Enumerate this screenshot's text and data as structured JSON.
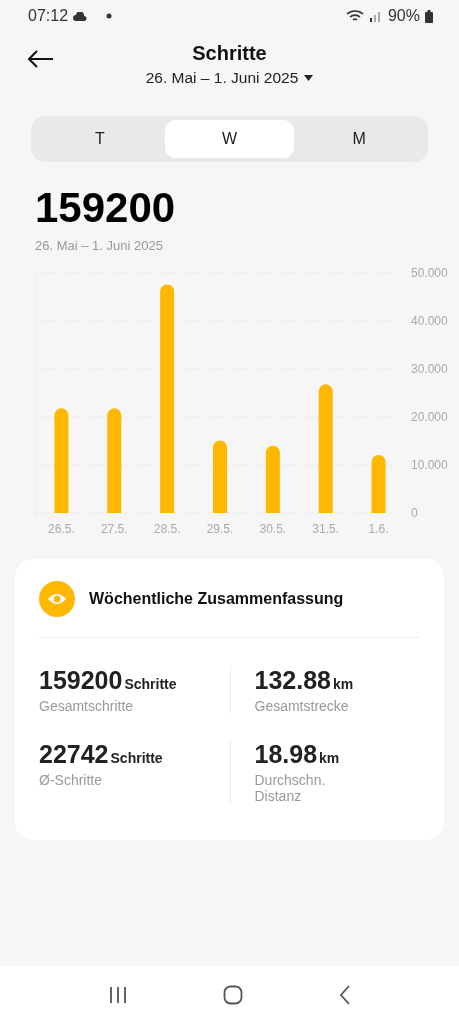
{
  "status_bar": {
    "time": "07:12",
    "battery": "90%"
  },
  "header": {
    "title": "Schritte",
    "date_range": "26. Mai – 1. Juni 2025"
  },
  "tabs": [
    {
      "label": "T",
      "selected": false
    },
    {
      "label": "W",
      "selected": true
    },
    {
      "label": "M",
      "selected": false
    }
  ],
  "total": {
    "value": "159200",
    "date_range": "26. Mai – 1. Juni 2025"
  },
  "chart_data": {
    "type": "bar",
    "categories": [
      "26.5.",
      "27.5.",
      "28.5.",
      "29.5.",
      "30.5.",
      "31.5.",
      "1.6."
    ],
    "series": [
      {
        "color": "#ffb800",
        "values": [
          21.8,
          21.8,
          47.6,
          15.1,
          14.0,
          26.8,
          12.1
        ]
      }
    ],
    "ylim": [
      0,
      50
    ],
    "grid": true,
    "yticks": [
      {
        "value": 0,
        "label": "0"
      },
      {
        "value": 10,
        "label": "10.000"
      },
      {
        "value": 20,
        "label": "20.000"
      },
      {
        "value": 30,
        "label": "30.000"
      },
      {
        "value": 40,
        "label": "40.000"
      },
      {
        "value": 50,
        "label": "50.000"
      }
    ]
  },
  "summary": {
    "title": "Wöchentliche Zusammenfassung",
    "stats": [
      {
        "value": "159200",
        "unit": "Schritte",
        "label": "Gesamtschritte"
      },
      {
        "value": "132.88",
        "unit": "km",
        "label": "Gesamtstrecke"
      },
      {
        "value": "22742",
        "unit": "Schritte",
        "label": "Ø-Schritte"
      },
      {
        "value": "18.98",
        "unit": "km",
        "label": "Durchschn. Distanz"
      }
    ]
  }
}
